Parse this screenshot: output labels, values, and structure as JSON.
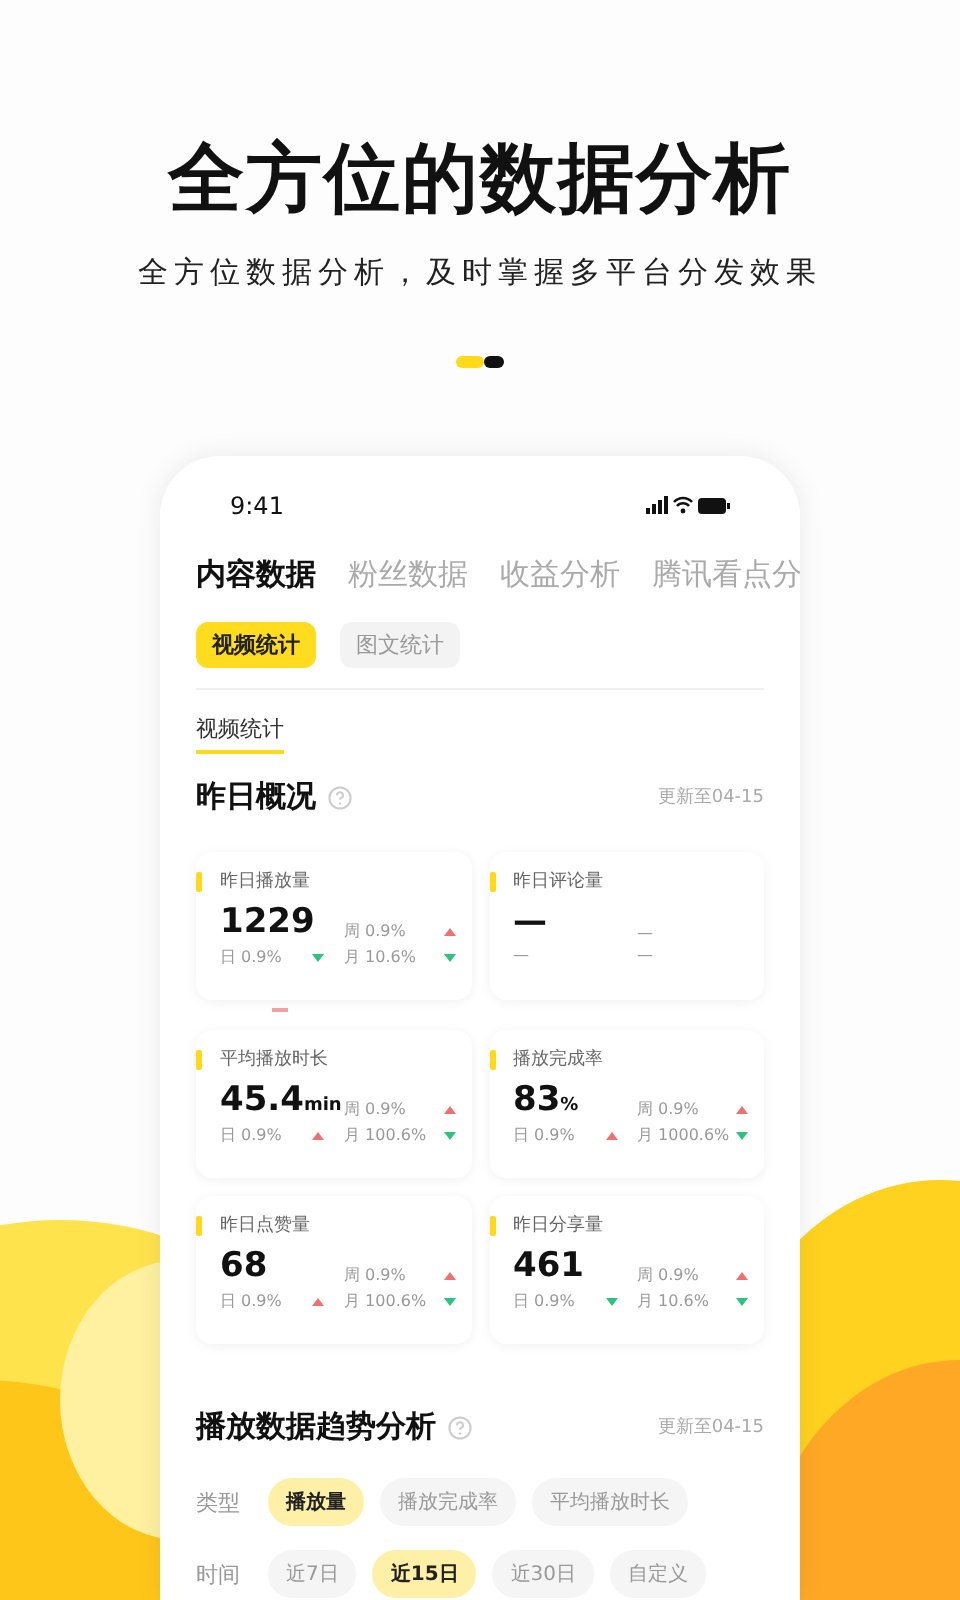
{
  "headline": "全方位的数据分析",
  "subtitle": "全方位数据分析，及时掌握多平台分发效果",
  "pager": [
    {
      "selected": true
    },
    {
      "selected": false
    }
  ],
  "phone": {
    "status_time": "9:41",
    "tabs": [
      {
        "label": "内容数据",
        "selected": true
      },
      {
        "label": "粉丝数据",
        "selected": false
      },
      {
        "label": "收益分析",
        "selected": false
      },
      {
        "label": "腾讯看点分",
        "selected": false
      }
    ],
    "sub_tabs": [
      {
        "label": "视频统计",
        "selected": true
      },
      {
        "label": "图文统计",
        "selected": false
      }
    ],
    "section_tab": "视频统计",
    "overview": {
      "title": "昨日概况",
      "updated": "更新至04-15",
      "cards": [
        {
          "title": "昨日播放量",
          "value": "1229",
          "week": {
            "label": "周",
            "value": "0.9%",
            "up": true
          },
          "day": {
            "label": "日",
            "value": "0.9%",
            "up": false
          },
          "month": {
            "label": "月",
            "value": "10.6%",
            "up": false
          }
        },
        {
          "title": "昨日评论量",
          "value": "—",
          "week": {
            "value": "—"
          },
          "day": {
            "value": "—"
          },
          "month": {
            "value": "—"
          }
        },
        {
          "title": "平均播放时长",
          "value": "45.4",
          "unit": "min",
          "week": {
            "label": "周",
            "value": "0.9%",
            "up": true
          },
          "day": {
            "label": "日",
            "value": "0.9%",
            "up": true
          },
          "month": {
            "label": "月",
            "value": "100.6%",
            "up": false
          }
        },
        {
          "title": "播放完成率",
          "value": "83",
          "unit": "%",
          "week": {
            "label": "周",
            "value": "0.9%",
            "up": true
          },
          "day": {
            "label": "日",
            "value": "0.9%",
            "up": true
          },
          "month": {
            "label": "月",
            "value": "1000.6%",
            "up": false
          }
        },
        {
          "title": "昨日点赞量",
          "value": "68",
          "week": {
            "label": "周",
            "value": "0.9%",
            "up": true
          },
          "day": {
            "label": "日",
            "value": "0.9%",
            "up": true
          },
          "month": {
            "label": "月",
            "value": "100.6%",
            "up": false
          }
        },
        {
          "title": "昨日分享量",
          "value": "461",
          "week": {
            "label": "周",
            "value": "0.9%",
            "up": true
          },
          "day": {
            "label": "日",
            "value": "0.9%",
            "up": false
          },
          "month": {
            "label": "月",
            "value": "10.6%",
            "up": false
          }
        }
      ]
    },
    "trend": {
      "title": "播放数据趋势分析",
      "updated": "更新至04-15",
      "filters": [
        {
          "label": "类型",
          "options": [
            {
              "label": "播放量",
              "selected": true
            },
            {
              "label": "播放完成率",
              "selected": false
            },
            {
              "label": "平均播放时长",
              "selected": false
            }
          ]
        },
        {
          "label": "时间",
          "options": [
            {
              "label": "近7日",
              "selected": false
            },
            {
              "label": "近15日",
              "selected": true
            },
            {
              "label": "近30日",
              "selected": false
            },
            {
              "label": "自定义",
              "selected": false
            }
          ]
        }
      ]
    }
  }
}
